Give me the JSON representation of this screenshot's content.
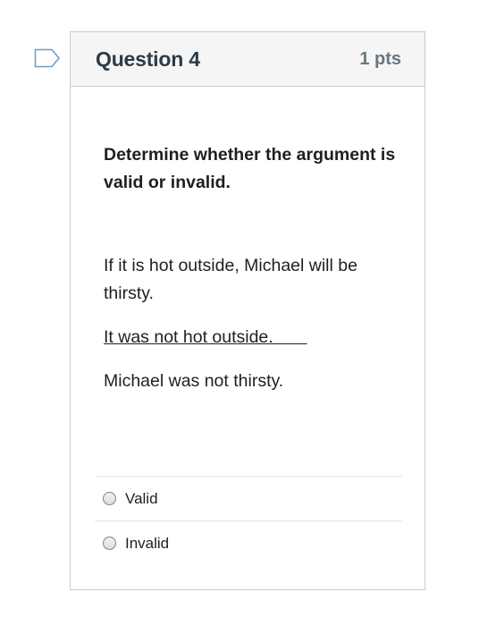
{
  "question": {
    "title": "Question 4",
    "points": "1 pts",
    "prompt": "Determine whether the argument is valid or invalid.",
    "premises": [
      "If it is hot outside, Michael will be thirsty.",
      "It was not hot outside.       ",
      "Michael was not thirsty."
    ],
    "answers": [
      {
        "label": "Valid",
        "selected": false
      },
      {
        "label": "Invalid",
        "selected": false
      }
    ]
  },
  "colors": {
    "header_bg": "#f5f5f5",
    "border": "#c7cdd1",
    "flag": "#6f9fc9"
  }
}
